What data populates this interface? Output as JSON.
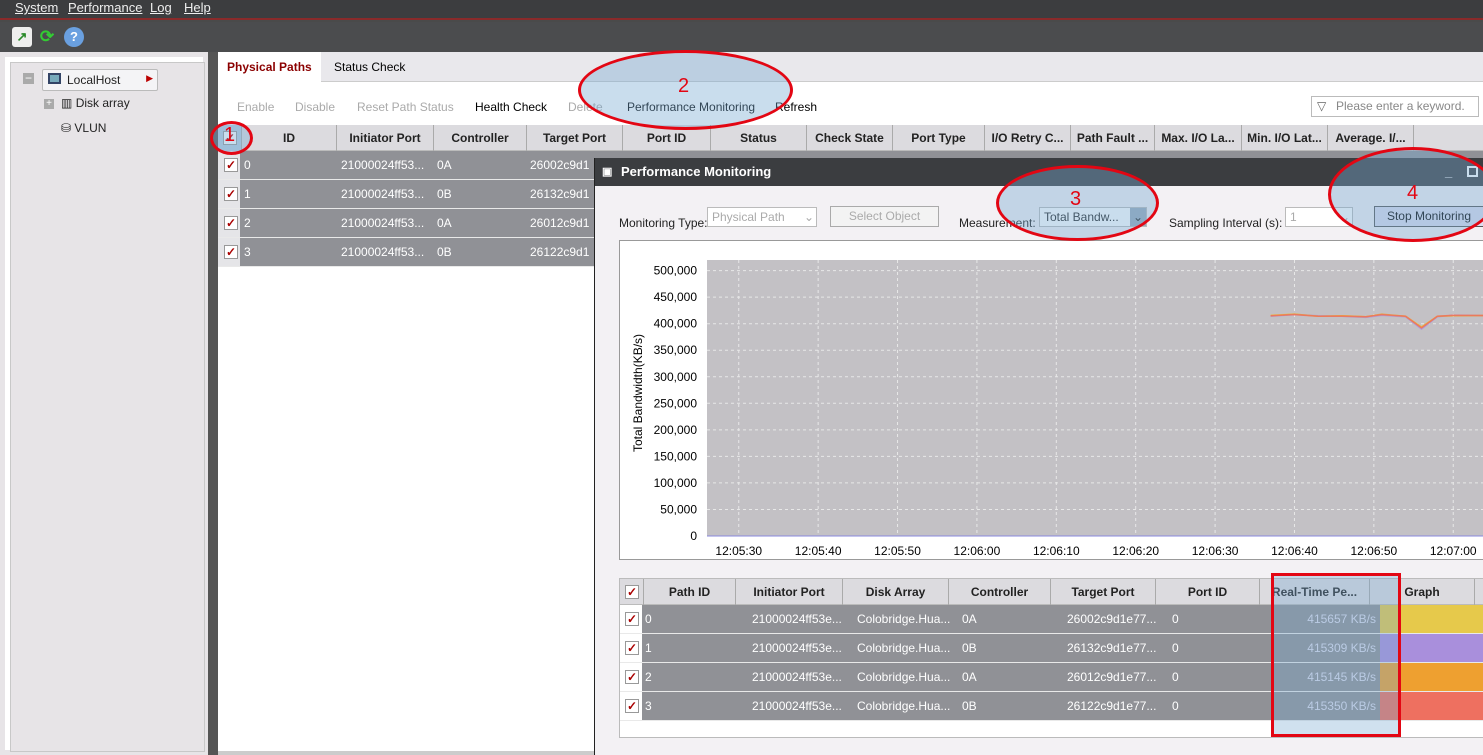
{
  "menu": [
    "System",
    "Performance",
    "Log",
    "Help"
  ],
  "toolbar_icons": [
    "performance-chart-icon",
    "refresh-icon",
    "help-icon"
  ],
  "tree": {
    "root": "LocalHost",
    "children": [
      "Disk array",
      "VLUN"
    ]
  },
  "tabs": [
    {
      "label": "Physical Paths",
      "active": true
    },
    {
      "label": "Status Check",
      "active": false
    }
  ],
  "actions": [
    {
      "label": "Enable",
      "enabled": false
    },
    {
      "label": "Disable",
      "enabled": false
    },
    {
      "label": "Reset Path Status",
      "enabled": false
    },
    {
      "label": "Health Check",
      "enabled": true
    },
    {
      "label": "Delete",
      "enabled": false
    },
    {
      "label": "Performance Monitoring",
      "enabled": true
    },
    {
      "label": "Refresh",
      "enabled": true
    }
  ],
  "search": {
    "placeholder": "Please enter a keyword."
  },
  "paths_table": {
    "columns": [
      "ID",
      "Initiator Port",
      "Controller",
      "Target Port",
      "Port ID",
      "Status",
      "Check State",
      "Port Type",
      "I/O Retry C...",
      "Path Fault ...",
      "Max. I/O La...",
      "Min. I/O Lat...",
      "Average. I/..."
    ],
    "rows": [
      [
        "0",
        "21000024ff53...",
        "0A",
        "26002c9d1"
      ],
      [
        "1",
        "21000024ff53...",
        "0B",
        "26132c9d1"
      ],
      [
        "2",
        "21000024ff53...",
        "0A",
        "26012c9d1"
      ],
      [
        "3",
        "21000024ff53...",
        "0B",
        "26122c9d1"
      ]
    ]
  },
  "monitor": {
    "title": "Performance Monitoring",
    "monitoring_type_label": "Monitoring Type:",
    "monitoring_type": "Physical Path",
    "select_object": "Select Object",
    "measurement_label": "Measurement:",
    "measurement": "Total Bandw...",
    "interval_label": "Sampling Interval (s):",
    "interval": "1",
    "stop": "Stop Monitoring",
    "table": {
      "columns": [
        "Path ID",
        "Initiator Port",
        "Disk Array",
        "Controller",
        "Target Port",
        "Port ID",
        "Real-Time Pe...",
        "Graph"
      ],
      "rows": [
        {
          "cells": [
            "0",
            "21000024ff53e...",
            "Colobridge.Hua...",
            "0A",
            "26002c9d1e77...",
            "0",
            "415657 KB/s"
          ],
          "color": "#e6c94b"
        },
        {
          "cells": [
            "1",
            "21000024ff53e...",
            "Colobridge.Hua...",
            "0B",
            "26132c9d1e77...",
            "0",
            "415309 KB/s"
          ],
          "color": "#a98fdc"
        },
        {
          "cells": [
            "2",
            "21000024ff53e...",
            "Colobridge.Hua...",
            "0A",
            "26012c9d1e77...",
            "0",
            "415145 KB/s"
          ],
          "color": "#eea030"
        },
        {
          "cells": [
            "3",
            "21000024ff53e...",
            "Colobridge.Hua...",
            "0B",
            "26122c9d1e77...",
            "0",
            "415350 KB/s"
          ],
          "color": "#ee7060"
        }
      ]
    }
  },
  "annotations": [
    "1",
    "2",
    "3",
    "4"
  ],
  "chart_data": {
    "type": "line",
    "ylabel": "Total Bandwidth(KB/s)",
    "ylim": [
      0,
      520000
    ],
    "yticks": [
      "0",
      "50,000",
      "100,000",
      "150,000",
      "200,000",
      "250,000",
      "300,000",
      "350,000",
      "400,000",
      "450,000",
      "500,000"
    ],
    "xticks": [
      "12:05:30",
      "12:05:40",
      "12:05:50",
      "12:06:00",
      "12:06:10",
      "12:06:20",
      "12:06:30",
      "12:06:40",
      "12:06:50",
      "12:07:00"
    ],
    "xlim": [
      "12:05:26",
      "12:07:04"
    ],
    "grid": true,
    "x": [
      "12:06:37",
      "12:06:40",
      "12:06:43",
      "12:06:46",
      "12:06:49",
      "12:06:51",
      "12:06:54",
      "12:06:56",
      "12:06:58",
      "12:07:00",
      "12:07:04"
    ],
    "series": [
      {
        "color": "#e6c94b",
        "values": [
          416000,
          418000,
          414000,
          415000,
          413000,
          417000,
          414000,
          394000,
          414000,
          415000,
          415657
        ]
      },
      {
        "color": "#a98fdc",
        "values": [
          414000,
          417000,
          415000,
          414000,
          412000,
          416000,
          413000,
          390000,
          413000,
          416000,
          415309
        ]
      },
      {
        "color": "#eea030",
        "values": [
          415000,
          418000,
          414000,
          415000,
          413000,
          418000,
          414000,
          393000,
          414000,
          415000,
          415145
        ]
      },
      {
        "color": "#ee7060",
        "values": [
          415000,
          417000,
          414000,
          414000,
          413000,
          417000,
          414000,
          392000,
          414000,
          416000,
          415350
        ]
      }
    ]
  }
}
